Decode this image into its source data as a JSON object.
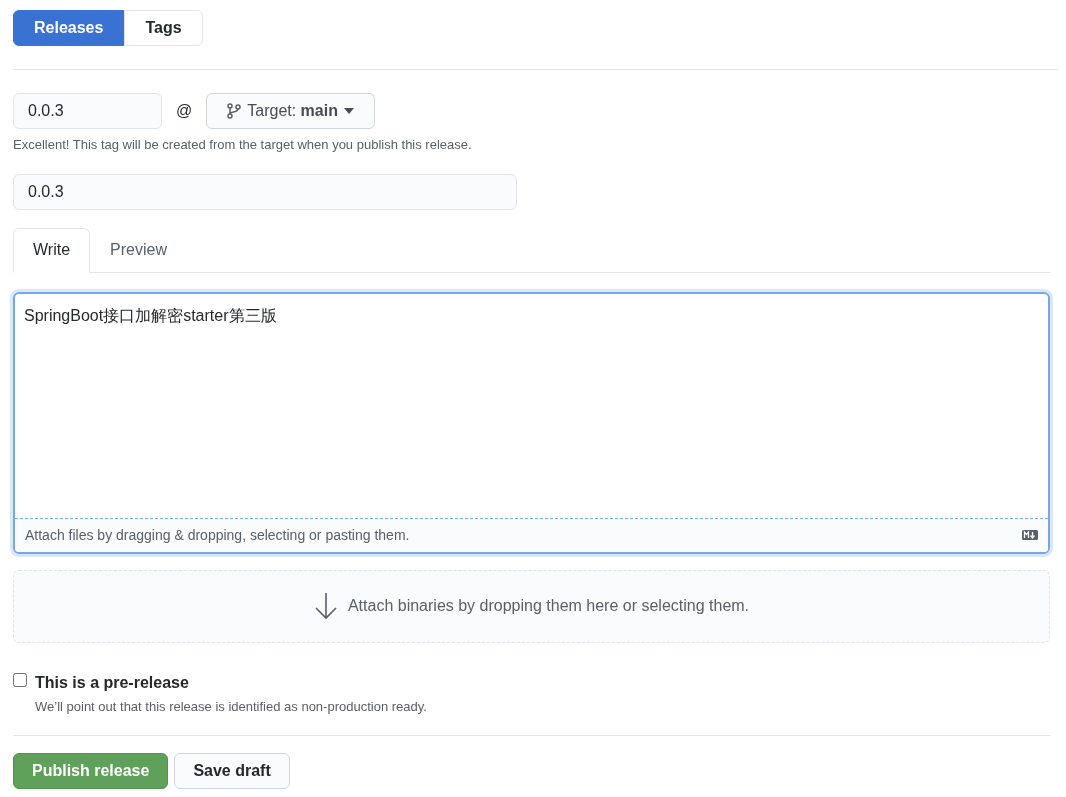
{
  "nav_tabs": [
    {
      "label": "Releases",
      "selected": true
    },
    {
      "label": "Tags",
      "selected": false
    }
  ],
  "tag_field": {
    "value": "0.0.3"
  },
  "at_sign": "@",
  "target_button": {
    "label": "Target: **main**"
  },
  "tag_hint": "Excellent! This tag will be created from the target when you publish this release.",
  "title_field": {
    "value": "0.0.3"
  },
  "editor_tabs": [
    {
      "label": "Write",
      "selected": true
    },
    {
      "label": "Preview",
      "selected": false
    }
  ],
  "body_field": {
    "value": "SpringBoot接口加解密starter第三版"
  },
  "attach_files_hint": "Attach files by dragging & dropping, selecting or pasting them.",
  "binaries_drop_text": "Attach binaries by dropping them here or selecting them.",
  "prerelease": {
    "label": "This is a pre-release",
    "checked": false,
    "description": "We’ll point out that this release is identified as non-production ready."
  },
  "buttons": [
    {
      "label": "Publish release",
      "kind": "primary"
    },
    {
      "label": "Save draft",
      "kind": "secondary"
    }
  ]
}
